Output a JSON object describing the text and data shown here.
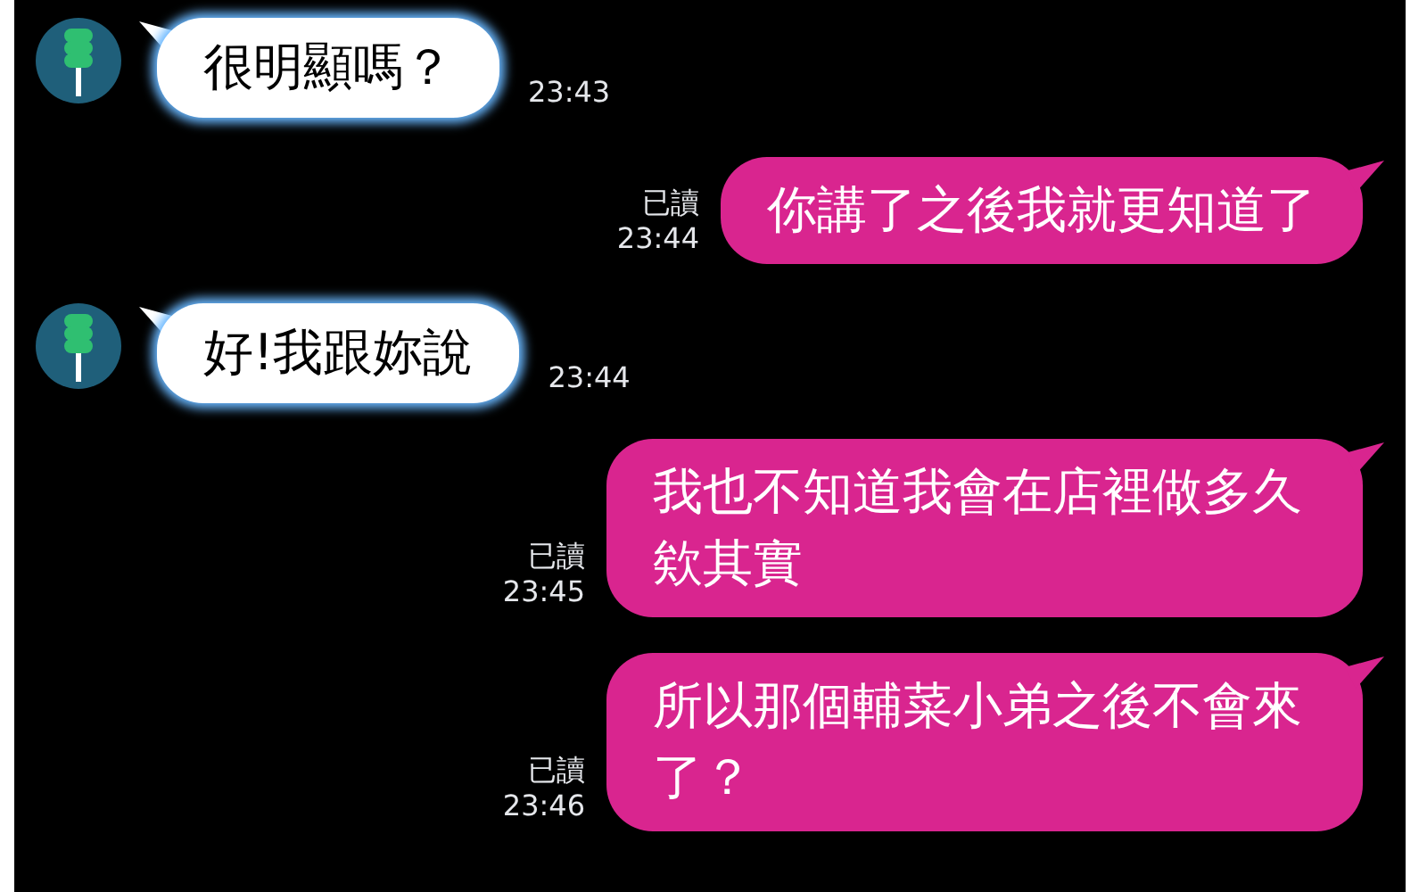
{
  "messages": [
    {
      "kind": "incoming",
      "text": "很明顯嗎？",
      "time": "23:43"
    },
    {
      "kind": "outgoing",
      "text": "你講了之後我就更知道了",
      "read": "已讀",
      "time": "23:44"
    },
    {
      "kind": "incoming",
      "text": "好!我跟妳說",
      "time": "23:44"
    },
    {
      "kind": "outgoing",
      "text": "我也不知道我會在店裡做多久欸其實",
      "read": "已讀",
      "time": "23:45"
    },
    {
      "kind": "outgoing",
      "text": "所以那個輔菜小弟之後不會來了？",
      "read": "已讀",
      "time": "23:46"
    }
  ]
}
